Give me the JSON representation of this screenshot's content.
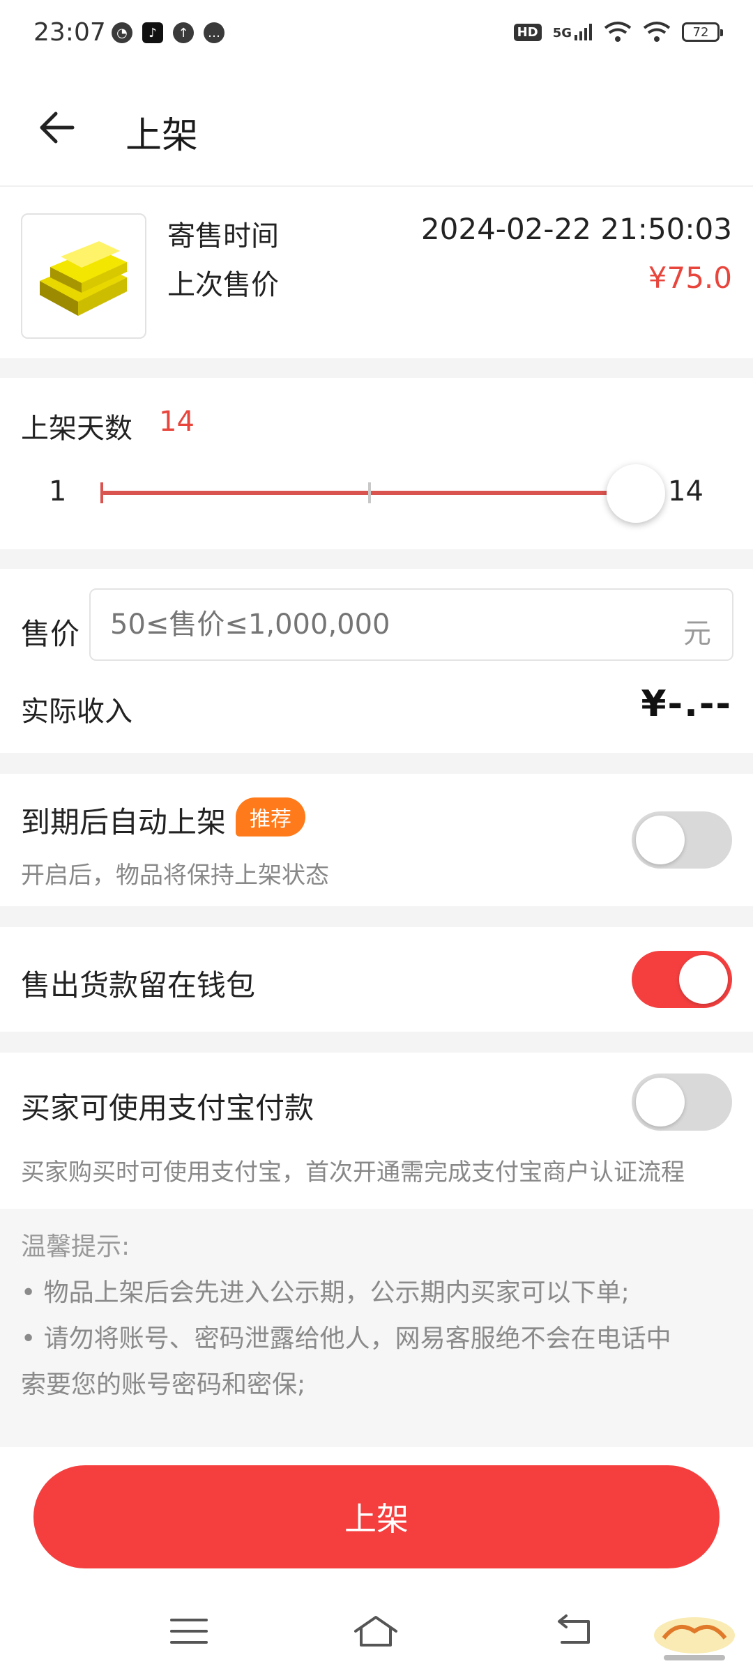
{
  "status_bar": {
    "time": "23:07",
    "network": "5G",
    "hd": "HD",
    "battery": "72"
  },
  "header": {
    "title": "上架"
  },
  "item_info": {
    "consign_time_label": "寄售时间",
    "consign_time_value": "2024-02-22 21:50:03",
    "last_price_label": "上次售价",
    "last_price_value": "¥75.0"
  },
  "listing_days": {
    "label": "上架天数",
    "value": "14",
    "min": "1",
    "max": "14",
    "current_fraction": 1.0
  },
  "price": {
    "label": "售价",
    "placeholder": "50≤售价≤1,000,000",
    "unit": "元",
    "income_label": "实际收入",
    "income_value": "¥-.--"
  },
  "auto_relist": {
    "title": "到期后自动上架",
    "badge": "推荐",
    "subtitle": "开启后，物品将保持上架状态",
    "enabled": false
  },
  "keep_wallet": {
    "title": "售出货款留在钱包",
    "enabled": true
  },
  "alipay": {
    "title": "买家可使用支付宝付款",
    "subtitle": "买家购买时可使用支付宝，首次开通需完成支付宝商户认证流程",
    "enabled": false
  },
  "tips": {
    "title": "温馨提示:",
    "line1": "• 物品上架后会先进入公示期，公示期内买家可以下单;",
    "line2": "• 请勿将账号、密码泄露给他人，网易客服绝不会在电话中",
    "line3": "索要您的账号密码和密保;"
  },
  "submit": {
    "label": "上架"
  },
  "colors": {
    "accent": "#f53f3f",
    "price_red": "#e8453c",
    "badge_orange": "#ff7a1a",
    "toggle_off": "#d9d9d9"
  }
}
